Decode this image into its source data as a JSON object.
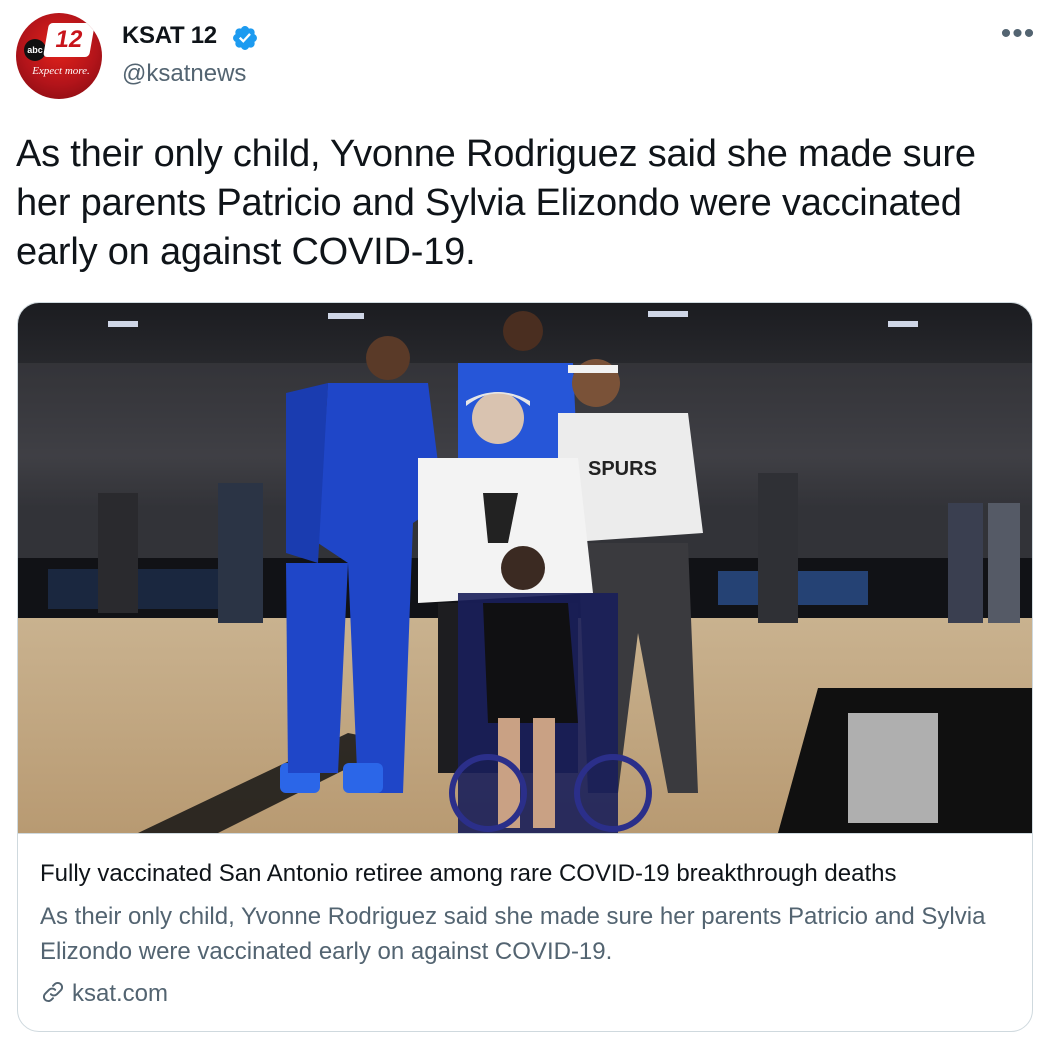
{
  "account": {
    "display_name": "KSAT 12",
    "handle": "@ksatnews",
    "verified": true,
    "avatar": {
      "logo_text": "12",
      "logo_network": "abc",
      "logo_tagline": "Expect more."
    }
  },
  "menu": {
    "more_label": "•••"
  },
  "tweet": {
    "text": "As their only child, Yvonne Rodriguez said she made sure her parents Patricio and Sylvia Elizondo were vaccinated early on against COVID-19."
  },
  "card": {
    "image_icon": "photo-of-family-with-basketball-players",
    "title": "Fully vaccinated San Antonio retiree among rare COVID-19 breakthrough deaths",
    "description": "As their only child, Yvonne Rodriguez said she made sure her parents Patricio and Sylvia Elizondo were vaccinated early on against COVID-19.",
    "domain": "ksat.com",
    "domain_icon": "link-icon"
  },
  "colors": {
    "verified": "#1d9bf0",
    "secondary_text": "#536471",
    "border": "#cfd9de",
    "brand_red": "#c8141b"
  }
}
